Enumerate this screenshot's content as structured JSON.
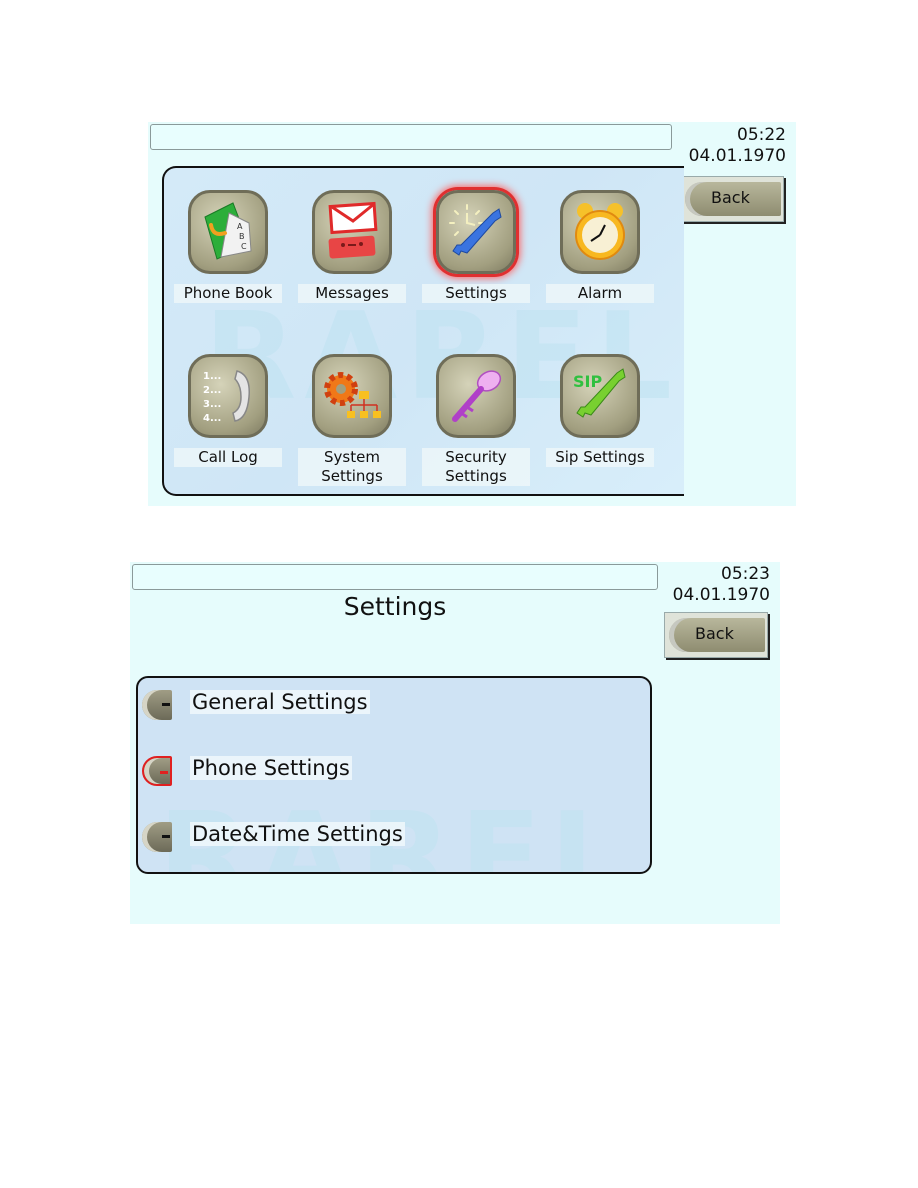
{
  "screen1": {
    "clock": {
      "time": "05:22",
      "date": "04.01.1970"
    },
    "back_label": "Back",
    "watermark": "RAREL",
    "menu": [
      {
        "label": "Phone Book",
        "icon": "phone-book-icon"
      },
      {
        "label": "Messages",
        "icon": "messages-icon"
      },
      {
        "label": "Settings",
        "icon": "settings-icon",
        "selected": true
      },
      {
        "label": "Alarm",
        "icon": "alarm-clock-icon"
      },
      {
        "label": "Call Log",
        "icon": "call-log-icon"
      },
      {
        "label_line1": "System",
        "label_line2": "Settings",
        "icon": "system-settings-icon"
      },
      {
        "label_line1": "Security",
        "label_line2": "Settings",
        "icon": "key-icon"
      },
      {
        "label": "Sip Settings",
        "icon": "sip-wrench-icon",
        "badge": "SIP"
      }
    ]
  },
  "screen2": {
    "clock": {
      "time": "05:23",
      "date": "04.01.1970"
    },
    "back_label": "Back",
    "title": "Settings",
    "watermark": "RAREL",
    "items": [
      {
        "label": "General Settings"
      },
      {
        "label": "Phone Settings",
        "selected": true
      },
      {
        "label": "Date&Time Settings"
      }
    ]
  },
  "colors": {
    "screen_bg": "#e6fcfc",
    "panel_bg": "#cfe6f6",
    "selection": "#e03030",
    "tile": "#a29f80"
  }
}
